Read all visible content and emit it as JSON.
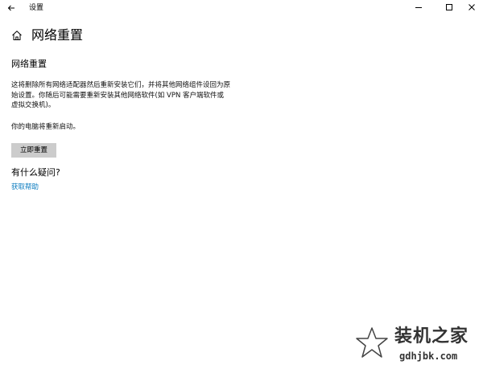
{
  "window": {
    "title": "设置",
    "back_icon": "back-arrow-icon",
    "controls": [
      "minimize-icon",
      "maximize-icon",
      "close-icon"
    ]
  },
  "page": {
    "title": "网络重置",
    "home_icon": "home-icon"
  },
  "section": {
    "title": "网络重置",
    "description": "这将删除所有网络适配器然后重新安装它们，并将其他网络组件设回为原始设置。你随后可能需要重新安装其他网络软件(如 VPN 客户端软件或虚拟交换机)。",
    "restart_note": "你的电脑将重新启动。",
    "reset_button": "立即重置"
  },
  "help": {
    "question": "有什么疑问?",
    "link": "获取帮助"
  },
  "watermark": {
    "name": "装机之家",
    "url": "gdhjbk.com"
  },
  "colors": {
    "background": "#ffffff",
    "button": "#cccccc",
    "link": "#0a7bbf"
  }
}
